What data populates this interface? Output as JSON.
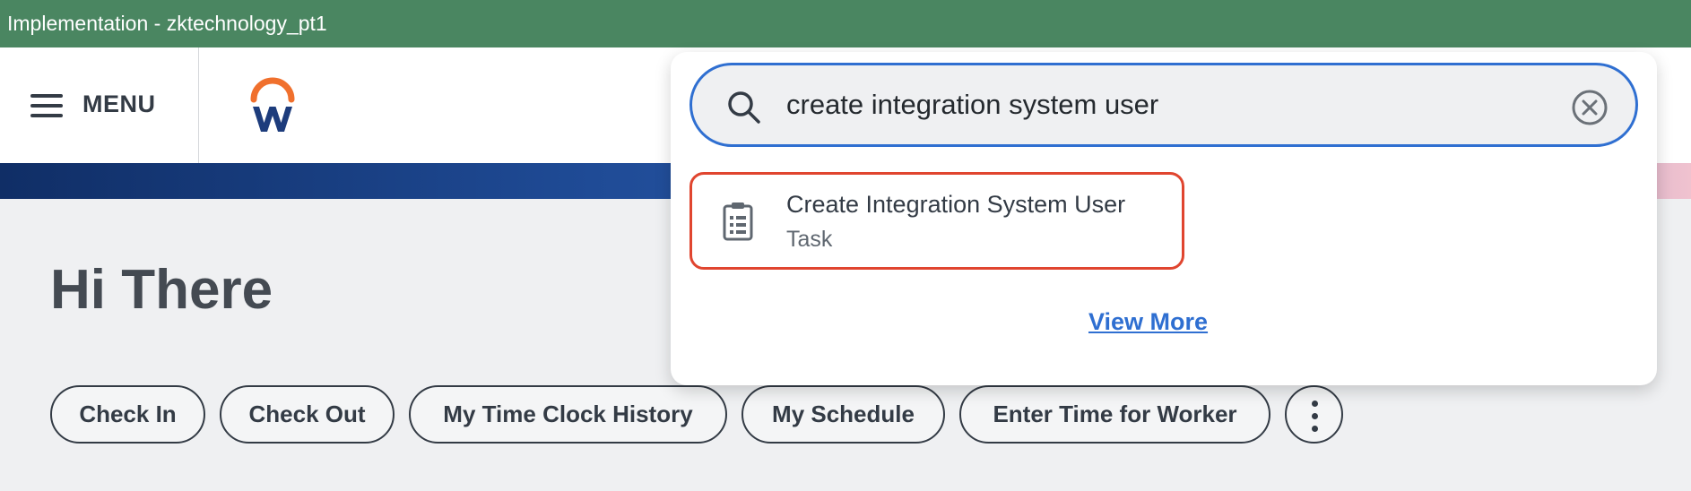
{
  "window": {
    "title": "Implementation - zktechnology_pt1"
  },
  "header": {
    "menu_label": "MENU",
    "logo_icon": "workday-logo-icon"
  },
  "home": {
    "greeting": "Hi There",
    "quick_actions": [
      {
        "label": "Check In"
      },
      {
        "label": "Check Out"
      },
      {
        "label": "My Time Clock History"
      },
      {
        "label": "My Schedule"
      },
      {
        "label": "Enter Time for Worker"
      }
    ],
    "more_icon": "vertical-ellipsis-icon"
  },
  "search": {
    "query": "create integration system user",
    "results": [
      {
        "title": "Create Integration System User",
        "type": "Task",
        "icon": "clipboard-icon"
      }
    ],
    "view_more_label": "View More"
  },
  "colors": {
    "titlebar": "#4a8661",
    "accent_blue": "#2f6fd1",
    "highlight_red": "#e0452f",
    "text_dark": "#333b45"
  }
}
